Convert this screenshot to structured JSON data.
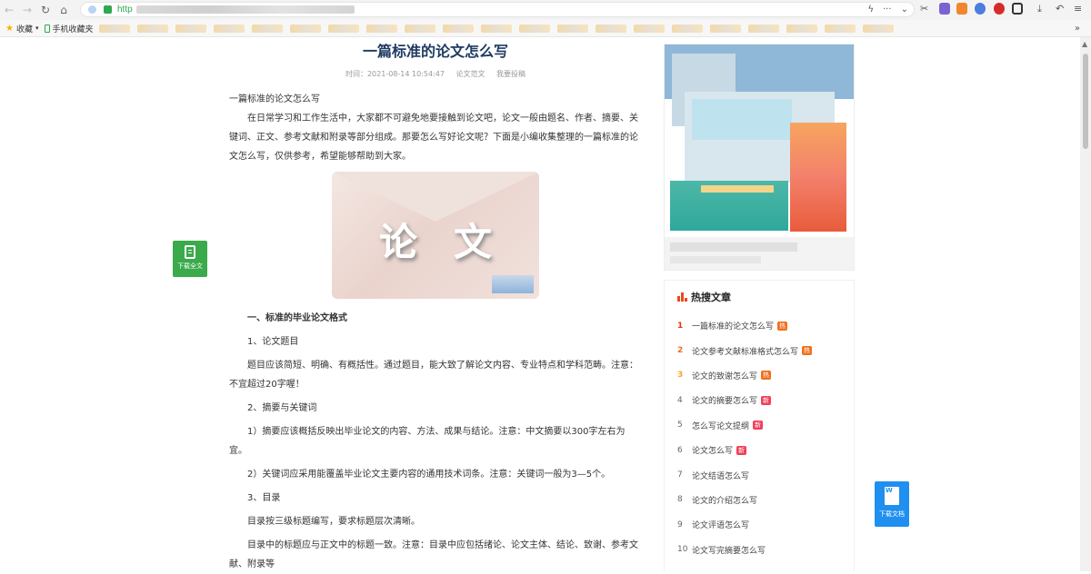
{
  "browser": {
    "url_prefix": "http",
    "address_right_icons": [
      "lightning-icon",
      "more-icon",
      "chevron-down-icon"
    ],
    "extension_icons": [
      "scissors-icon",
      "translate-icon",
      "mask-icon",
      "notify-icon",
      "block-icon",
      "grid-icon",
      "download-icon",
      "undo-icon",
      "menu-icon"
    ],
    "bookmarks": {
      "favorites_label": "收藏",
      "mobile_label": "手机收藏夹",
      "more": "»"
    }
  },
  "article": {
    "title": "一篇标准的论文怎么写",
    "meta": {
      "time": "时间：2021-08-14 10:54:47",
      "category": "论文范文",
      "submit": "我要投稿"
    },
    "intro_title": "一篇标准的论文怎么写",
    "intro": "在日常学习和工作生活中，大家都不可避免地要接触到论文吧，论文一般由题名、作者、摘要、关键词、正文、参考文献和附录等部分组成。那要怎么写好论文呢？下面是小编收集整理的一篇标准的论文怎么写，仅供参考，希望能够帮助到大家。",
    "hero_text": "论文",
    "sections": [
      {
        "type": "h2",
        "text": "一、标准的毕业论文格式"
      },
      {
        "type": "p",
        "text": "1、论文题目"
      },
      {
        "type": "p",
        "text": "题目应该简短、明确、有概括性。通过题目，能大致了解论文内容、专业特点和学科范畴。注意：不宜超过20字喔！"
      },
      {
        "type": "p",
        "text": "2、摘要与关键词"
      },
      {
        "type": "p",
        "text": "1）摘要应该概括反映出毕业论文的内容、方法、成果与结论。注意：中文摘要以300字左右为宜。"
      },
      {
        "type": "p",
        "text": "2）关键词应采用能覆盖毕业论文主要内容的通用技术词条。注意：关键词一般为3—5个。"
      },
      {
        "type": "p",
        "text": "3、目录"
      },
      {
        "type": "p",
        "text": "目录按三级标题编写，要求标题层次清晰。"
      },
      {
        "type": "p",
        "text": "目录中的标题应与正文中的标题一致。注意：目录中应包括绪论、论文主体、结论、致谢、参考文献、附录等"
      }
    ]
  },
  "float_left": {
    "label": "下载全文"
  },
  "float_right": {
    "label": "下载文档"
  },
  "hot": {
    "title": "热搜文章",
    "items": [
      {
        "rank": "1",
        "text": "一篇标准的论文怎么写",
        "badge": "热",
        "badge_type": "hot"
      },
      {
        "rank": "2",
        "text": "论文参考文献标准格式怎么写",
        "badge": "热",
        "badge_type": "hot"
      },
      {
        "rank": "3",
        "text": "论文的致谢怎么写",
        "badge": "热",
        "badge_type": "hot"
      },
      {
        "rank": "4",
        "text": "论文的摘要怎么写",
        "badge": "新",
        "badge_type": "new"
      },
      {
        "rank": "5",
        "text": "怎么写论文提纲",
        "badge": "新",
        "badge_type": "new"
      },
      {
        "rank": "6",
        "text": "论文怎么写",
        "badge": "新",
        "badge_type": "new"
      },
      {
        "rank": "7",
        "text": "论文结语怎么写",
        "badge": "",
        "badge_type": ""
      },
      {
        "rank": "8",
        "text": "论文的介绍怎么写",
        "badge": "",
        "badge_type": ""
      },
      {
        "rank": "9",
        "text": "论文评语怎么写",
        "badge": "",
        "badge_type": ""
      },
      {
        "rank": "10",
        "text": "论文写完摘要怎么写",
        "badge": "",
        "badge_type": ""
      }
    ]
  },
  "colors": {
    "title": "#1f3b63",
    "rank1": "#e8330c",
    "rank2": "#f06e1d",
    "rank3": "#f5a623",
    "badge_hot": "#f06e1d",
    "badge_new": "#f0405a",
    "download_full": "#3aaa4a",
    "download_doc": "#1f8ff0"
  }
}
